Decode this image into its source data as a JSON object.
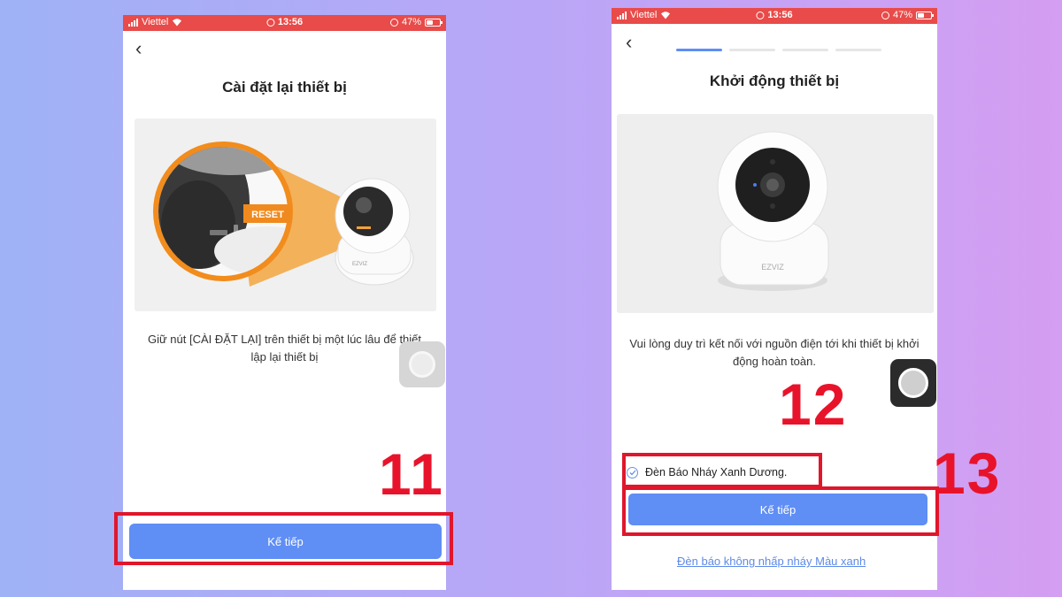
{
  "left_screen": {
    "status_bar": {
      "carrier": "Viettel",
      "time": "13:56",
      "battery": "47%",
      "battery_level": 0.47
    },
    "back_icon": "chevron-left-icon",
    "title": "Cài đặt lại thiết bị",
    "illustration": {
      "reset_label": "RESET",
      "brand": "EZVIZ"
    },
    "description": "Giữ nút [CÀI ĐẶT LẠI] trên thiết bị một lúc lâu để thiết lập lại thiết bị",
    "next_button": "Kế tiếp",
    "step_number": "11"
  },
  "right_screen": {
    "status_bar": {
      "carrier": "Viettel",
      "time": "13:56",
      "battery": "47%",
      "battery_level": 0.47
    },
    "back_icon": "chevron-left-icon",
    "progress": {
      "total_steps": 4,
      "current_step": 1
    },
    "title": "Khởi động thiết bị",
    "illustration": {
      "brand": "EZVIZ"
    },
    "description": "Vui lòng duy trì kết nối với nguồn điện tới khi thiết bị khởi động hoàn toàn.",
    "checkbox_label": "Đèn Báo Nháy Xanh Dương.",
    "checkbox_checked": true,
    "next_button": "Kế tiếp",
    "alt_link": "Đèn báo không nhấp nháy Màu xanh",
    "step_number_checkbox": "12",
    "step_number_button": "13"
  },
  "colors": {
    "status_bar": "#e84b49",
    "primary_button": "#5f8ef5",
    "highlight_box": "#e0162b",
    "progress_active": "#5f8ef5",
    "progress_inactive": "#e6e6e6",
    "reset_tag": "#f08a1e"
  }
}
